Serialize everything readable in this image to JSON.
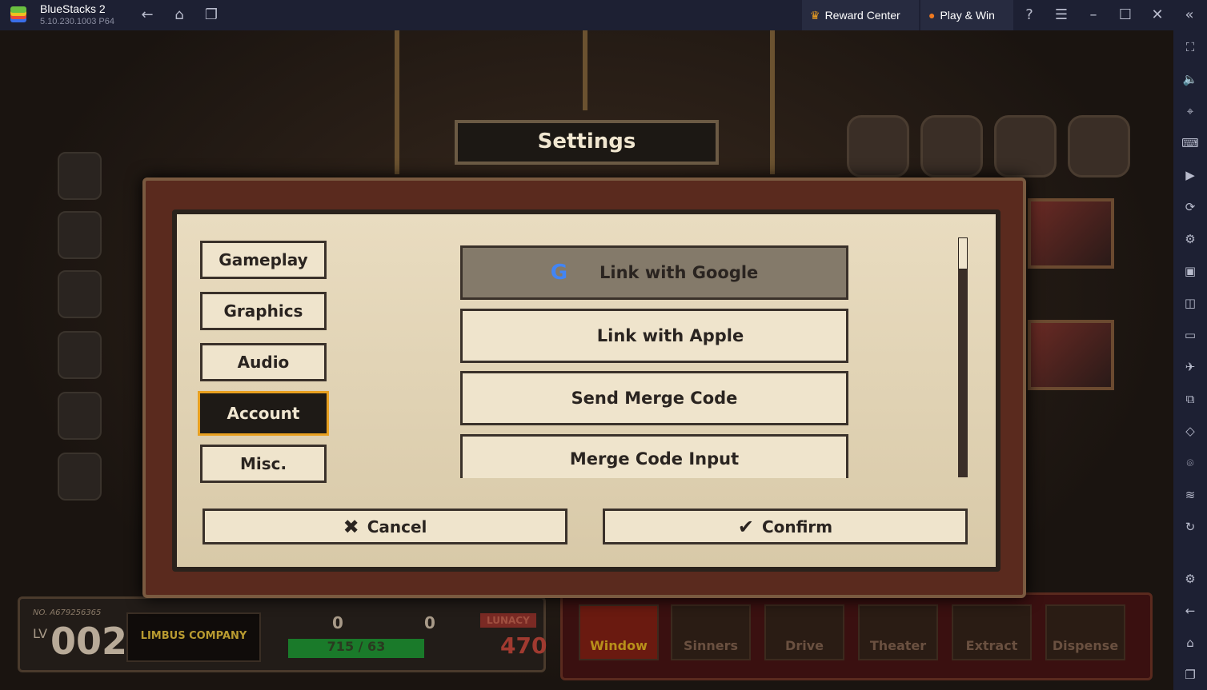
{
  "topbar": {
    "title": "BlueStacks 2",
    "version": "5.10.230.1003  P64",
    "reward_center": "Reward Center",
    "play_win": "Play & Win"
  },
  "sidebar": {
    "icons": [
      "fullscreen-icon",
      "volume-icon",
      "cursor-icon",
      "keyboard-icon",
      "record-icon",
      "rotate-icon",
      "macro-icon",
      "apk-icon",
      "screenshot-icon",
      "folder-icon",
      "airplane-icon",
      "multi-instance-icon",
      "eco-icon",
      "location-icon",
      "layers-icon",
      "sync-icon",
      "settings-icon",
      "back-icon",
      "home-icon",
      "recents-icon"
    ]
  },
  "settings": {
    "title": "Settings",
    "tabs": [
      {
        "label": "Gameplay"
      },
      {
        "label": "Graphics"
      },
      {
        "label": "Audio"
      },
      {
        "label": "Account",
        "selected": true
      },
      {
        "label": "Misc."
      }
    ],
    "account_buttons": [
      {
        "label": "Link with Google",
        "icon": "google-icon"
      },
      {
        "label": "Link with Apple",
        "icon": "apple-icon"
      },
      {
        "label": "Send Merge Code"
      },
      {
        "label": "Merge Code Input"
      }
    ],
    "cancel": "Cancel",
    "confirm": "Confirm"
  },
  "hud": {
    "player_no": "NO. A679256365",
    "lv_label": "LV",
    "level": "002",
    "logo_text": "LIMBUS COMPANY",
    "currency1": "0",
    "currency2": "0",
    "stamina": "715 / 63",
    "lunacy_label": "LUNACY",
    "lunacy": "470"
  },
  "nav": [
    {
      "label": "Window",
      "active": true
    },
    {
      "label": "Sinners"
    },
    {
      "label": "Drive"
    },
    {
      "label": "Theater"
    },
    {
      "label": "Extract"
    },
    {
      "label": "Dispense"
    }
  ],
  "colors": {
    "accent": "#e8a020",
    "topbar": "#1d2033"
  }
}
